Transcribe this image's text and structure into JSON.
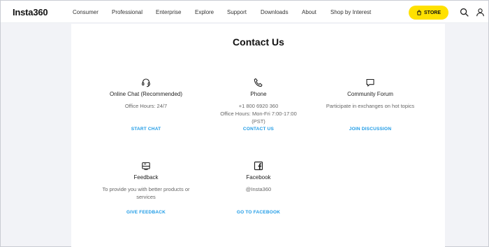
{
  "brand": "Insta360",
  "nav": {
    "links": [
      "Consumer",
      "Professional",
      "Enterprise",
      "Explore",
      "Support",
      "Downloads",
      "About",
      "Shop by Interest"
    ],
    "store_label": "STORE",
    "icons": [
      "search-icon",
      "user-icon"
    ]
  },
  "page": {
    "title": "Contact Us"
  },
  "cards": [
    {
      "icon": "headset-icon",
      "name": "Online Chat (Recommended)",
      "desc": [
        "Office Hours: 24/7"
      ],
      "action": "START CHAT"
    },
    {
      "icon": "phone-icon",
      "name": "Phone",
      "desc": [
        "+1 800 6920 360",
        "Office Hours: Mon-Fri 7:00-17:00",
        "(PST)"
      ],
      "action": "CONTACT US"
    },
    {
      "icon": "chat-bubble-icon",
      "name": "Community Forum",
      "desc": [
        "Participate in exchanges on hot topics"
      ],
      "action": "JOIN DISCUSSION"
    },
    {
      "icon": "feedback-icon",
      "name": "Feedback",
      "desc": [
        "To provide you with better products or",
        "services"
      ],
      "action": "GIVE FEEDBACK"
    },
    {
      "icon": "facebook-icon",
      "name": "Facebook",
      "desc": [
        "@Insta360"
      ],
      "action": "GO TO FACEBOOK"
    }
  ],
  "colors": {
    "accent": "#1e9be6",
    "store": "#ffe100",
    "background": "#f2f3f7"
  }
}
